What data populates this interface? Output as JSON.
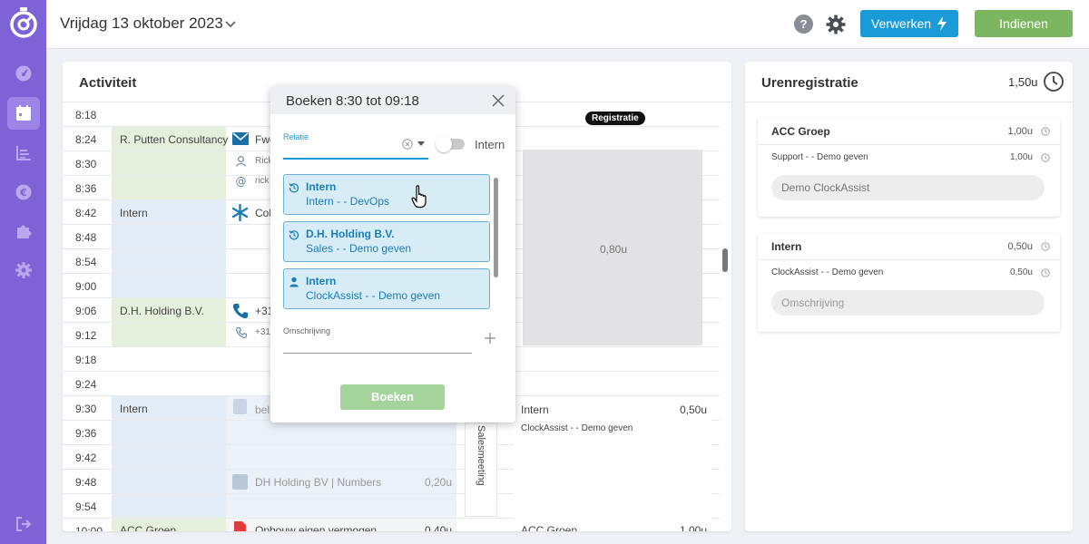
{
  "sidebar": {
    "items": [
      {
        "name": "dashboard-icon"
      },
      {
        "name": "calendar-icon",
        "active": true
      },
      {
        "name": "chart-icon"
      },
      {
        "name": "euro-icon"
      },
      {
        "name": "puzzle-icon"
      },
      {
        "name": "gear-icon"
      }
    ],
    "logout": "logout-icon"
  },
  "header": {
    "date": "Vrijdag 13 oktober 2023",
    "help": "?",
    "verwerken_label": "Verwerken",
    "indienen_label": "Indienen"
  },
  "activity": {
    "title": "Activiteit",
    "times": [
      "8:18",
      "8:24",
      "8:30",
      "8:36",
      "8:42",
      "8:48",
      "8:54",
      "9:00",
      "9:06",
      "9:12",
      "9:18",
      "9:24",
      "9:30",
      "9:36",
      "9:42",
      "9:48",
      "9:54",
      "10:00"
    ],
    "relations": [
      {
        "label": "R. Putten Consultancy",
        "color": "#e5f0dc"
      },
      {
        "label": "Intern",
        "color": "#e2ecf6"
      },
      {
        "label": "D.H. Holding B.V.",
        "color": "#e5f0dc"
      },
      {
        "label": "Intern",
        "color": "#e2ecf6"
      },
      {
        "label": "ACC Groep",
        "color": "#e5f0dc"
      }
    ],
    "events": {
      "email_subject": "Fwd",
      "contact_name": "Rick",
      "contact_mail": "rick",
      "call_label": "Coll",
      "phone_1": "+31",
      "phone_2": "+31",
      "beltegoed": "bel",
      "numbers_label": "DH Holding BV | Numbers",
      "numbers_hours": "0,20u",
      "opbouw_label": "Opbouw eigen vermogen",
      "opbouw_hours": "0,40u"
    },
    "registratie_badge": "Registratie",
    "gray_value": "0,80u",
    "salesmeeting": "Salesmeeting",
    "booked": {
      "title": "Intern",
      "hours": "0,50u",
      "sub": "ClockAssist - - Demo geven",
      "next_title": "ACC Groep",
      "next_hours": "1,00u"
    }
  },
  "popup": {
    "title": "Boeken 8:30 tot 09:18",
    "relatie_label": "Relatie",
    "toggle_label": "Intern",
    "suggestions": [
      {
        "title": "Intern",
        "sub": "Intern -  - DevOps",
        "icon": "history-icon"
      },
      {
        "title": "D.H. Holding B.V.",
        "sub": "Sales -  - Demo geven",
        "icon": "history-icon"
      },
      {
        "title": "Intern",
        "sub": "ClockAssist -  - Demo geven",
        "icon": "user-icon"
      }
    ],
    "omschrijving_label": "Omschrijving",
    "boeken_label": "Boeken"
  },
  "uren": {
    "title": "Urenregistratie",
    "total": "1,50u",
    "cards": [
      {
        "title": "ACC Groep",
        "hours": "1,00u",
        "sub": "Support -  - Demo geven",
        "sub_hours": "1,00u",
        "input_value": "Demo ClockAssist"
      },
      {
        "title": "Intern",
        "hours": "0,50u",
        "sub": "ClockAssist -  - Demo geven",
        "sub_hours": "0,50u",
        "input_placeholder": "Omschrijving"
      }
    ]
  },
  "colors": {
    "sidebar": "#7e63d6",
    "primary": "#1a9ad6",
    "success": "#7db660"
  }
}
